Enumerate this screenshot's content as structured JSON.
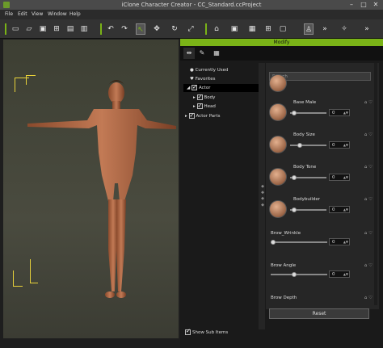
{
  "window": {
    "title": "iClone Character Creator - CC_Standard.ccProject"
  },
  "menu": [
    "File",
    "Edit",
    "View",
    "Window",
    "Help"
  ],
  "toolbar": {
    "icons": [
      "save-icon",
      "open-folder-icon",
      "save-disk-icon",
      "export-icon",
      "export-alt-icon",
      "import-icon",
      "undo-icon",
      "redo-icon",
      "select-icon",
      "move-icon",
      "rotate-icon",
      "scale-icon",
      "home-icon",
      "camera-icon",
      "view-icon",
      "grid-icon",
      "frame-icon",
      "figure-icon",
      "more-icon",
      "tools-icon",
      "more-icon"
    ]
  },
  "panel": {
    "header": "Modify",
    "tabs": [
      "morph-tab-icon",
      "wrench-tab-icon",
      "checker-tab-icon"
    ],
    "tree": [
      {
        "label": "Currently Used",
        "icon": "bullet"
      },
      {
        "label": "Favorites",
        "icon": "heart"
      },
      {
        "label": "Actor",
        "selected": true
      },
      {
        "label": "Body"
      },
      {
        "label": "Head"
      },
      {
        "label": "Actor Parts"
      }
    ],
    "search_placeholder": "Search",
    "morphs": [
      {
        "label": "Base Male",
        "value": "0"
      },
      {
        "label": "Body Size",
        "value": "0"
      },
      {
        "label": "Body Tone",
        "value": "0"
      },
      {
        "label": "Bodybuilder",
        "value": "0"
      }
    ],
    "sliders": [
      {
        "label": "Brow_Wrinkle",
        "value": "0"
      },
      {
        "label": "Brow Angle",
        "value": "0"
      },
      {
        "label": "Brow Depth",
        "value": ""
      }
    ],
    "reset_label": "Reset",
    "show_sub_items": "Show Sub Items",
    "divider_glyph": "◆ ◆ ◆ ◆"
  },
  "colors": {
    "accent": "#7ab317",
    "bracket": "#e8d23a"
  }
}
